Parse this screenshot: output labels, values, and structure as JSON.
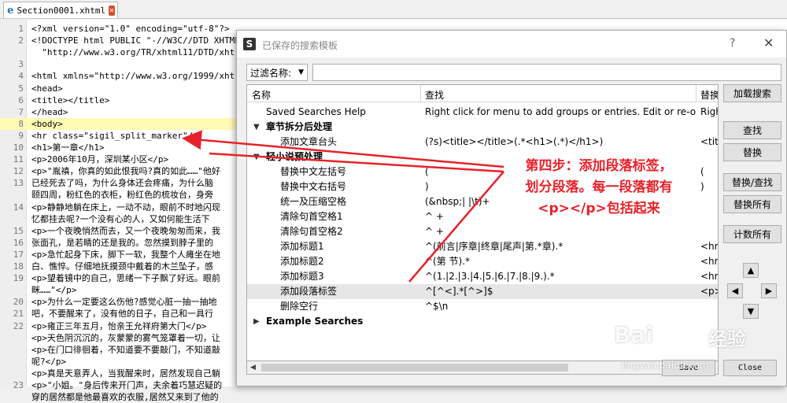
{
  "editor": {
    "tab_title": "Section0001.xhtml",
    "tab_icon": "e",
    "close_glyph": "✕",
    "lines": [
      {
        "no": "1",
        "text": "<?xml version=\"1.0\" encoding=\"utf-8\"?>"
      },
      {
        "no": "2",
        "text": "<!DOCTYPE html PUBLIC \"-//W3C//DTD XHTML"
      },
      {
        "no": "",
        "text": "  \"http://www.w3.org/TR/xhtml11/DTD/xht"
      },
      {
        "no": "3",
        "text": ""
      },
      {
        "no": "4",
        "text": "<html xmlns=\"http://www.w3.org/1999/xht"
      },
      {
        "no": "5",
        "text": "<head>"
      },
      {
        "no": "6",
        "text": "<title></title>"
      },
      {
        "no": "7",
        "text": "</head>"
      },
      {
        "no": "8",
        "text": "<body>"
      },
      {
        "no": "9",
        "text": "<hr class=\"sigil_split_marker\"/>"
      },
      {
        "no": "10",
        "text": "<h1>第一章</h1>"
      },
      {
        "no": "11",
        "text": "<p>2006年10月，深圳某小区</p>"
      },
      {
        "no": "12",
        "text": "<p>\"胤禛，你真的如此恨我吗?真的如此……\"他好"
      },
      {
        "no": "13",
        "text": "已经死去了吗，为什么身体还会疼痛，为什么脑"
      },
      {
        "no": "",
        "text": "颐四周，粉红色的衣柜，粉红色的梳妆台，身旁"
      },
      {
        "no": "14",
        "text": "<p>静静地躺在床上，一动不动，眼前不时地闪现"
      },
      {
        "no": "",
        "text": "忆都挂去呢?一个没有心的人，又如何能生活下"
      },
      {
        "no": "15",
        "text": "<p>一个夜晚悄然而去，又一个夜晚匆匆而来，我"
      },
      {
        "no": "16",
        "text": "张面孔，是若睛的还是我的。忽然摸到脖子里的"
      },
      {
        "no": "17",
        "text": "<p>急忙起身下床，脚下一软，我整个人瘫坐在地"
      },
      {
        "no": "18",
        "text": "白、憔悴。仔细地抚摸颈中戴着的木兰坠子，感"
      },
      {
        "no": "19",
        "text": "<p>望着镜中的自己，思绪一下子飘了好远。眼前"
      },
      {
        "no": "",
        "text": "眯……\"</p>"
      },
      {
        "no": "20",
        "text": "<p>为什么一定要这么伤他?感觉心脏一抽一抽地"
      },
      {
        "no": "21",
        "text": "吧，不要醒来了，没有他的日子，自己和一具行"
      },
      {
        "no": "22",
        "text": "<p>雍正三年五月，怡亲王允祥府第大门</p>"
      },
      {
        "no": "",
        "text": "<p>天色阴沉沉的，灰蒙蒙的雾气笼罩着一切，让"
      },
      {
        "no": "",
        "text": "<p>在门口徘徊着，不知道要不要敲门，不知道敲"
      },
      {
        "no": "",
        "text": "呢?</p>"
      },
      {
        "no": "",
        "text": "<p>真是天意弄人，当我醒来时，居然发现自己躺"
      },
      {
        "no": "23",
        "text": "<p>\"小姐。\"身后传来开门声，夫余着巧慧迟疑的"
      },
      {
        "no": "",
        "text": "穿的居然都是他最喜欢的衣服,居然又来到了他的"
      }
    ]
  },
  "dialog": {
    "title": "已保存的搜索模板",
    "app_icon": "S",
    "help_label": "?",
    "close_label": "✕",
    "filter_label": "过滤名称:",
    "filter_value": "",
    "columns": [
      "名称",
      "查找",
      "替换"
    ],
    "rows": [
      {
        "name": "Saved Searches Help",
        "find": "Right click for menu to add groups or entries.  Edit or re-o...",
        "repl": "Righ",
        "group": false,
        "arrow": ""
      },
      {
        "name": "章节拆分后处理",
        "find": "",
        "repl": "",
        "group": true,
        "arrow": "▼"
      },
      {
        "name": "添加文章台头",
        "find": "(?s)<title></title>(.*<h1>(.*)</h1>)",
        "repl": "<titl",
        "group": false,
        "arrow": ""
      },
      {
        "name": "轻小说预处理",
        "find": "",
        "repl": "",
        "group": true,
        "arrow": "▼"
      },
      {
        "name": "替换中文左括号",
        "find": "(",
        "repl": "(",
        "group": false,
        "arrow": ""
      },
      {
        "name": "替换中文右括号",
        "find": ")",
        "repl": ")",
        "group": false,
        "arrow": ""
      },
      {
        "name": "统一及压缩空格",
        "find": "(&nbsp;|  |\\t)+",
        "repl": "",
        "group": false,
        "arrow": ""
      },
      {
        "name": "清除句首空格1",
        "find": "^ +",
        "repl": "",
        "group": false,
        "arrow": ""
      },
      {
        "name": "清除句首空格2",
        "find": "^ +",
        "repl": "",
        "group": false,
        "arrow": ""
      },
      {
        "name": "添加标题1",
        "find": "^(前言|序章|终章|尾声|第.*章).*",
        "repl": "<hr",
        "group": false,
        "arrow": ""
      },
      {
        "name": "添加标题2",
        "find": "^(第 节).*",
        "repl": "<hr",
        "group": false,
        "arrow": ""
      },
      {
        "name": "添加标题3",
        "find": "^(1.|2.|3.|4.|5.|6.|7.|8.|9.).*",
        "repl": "<hr",
        "group": false,
        "arrow": ""
      },
      {
        "name": "添加段落标签",
        "find": "^[^<].*[^>]$",
        "repl": "<p>",
        "group": false,
        "arrow": "",
        "selected": true
      },
      {
        "name": "删除空行",
        "find": "^$\\n",
        "repl": "",
        "group": false,
        "arrow": ""
      },
      {
        "name": "Example Searches",
        "find": "",
        "repl": "",
        "group": true,
        "arrow": "▶"
      }
    ],
    "side_buttons": {
      "load": "加载搜索",
      "find": "查找",
      "replace": "替换",
      "replace_find": "替换/查找",
      "replace_all": "替换所有",
      "count_all": "计数所有"
    },
    "arrow_up": "▲",
    "arrow_left": "◀",
    "arrow_right": "▶",
    "arrow_down": "▼",
    "save_label": "Save",
    "close_button_label": "Close"
  },
  "annotation": {
    "line1": "第四步：添加段落标签，",
    "line2": "划分段落。每一段落都有",
    "line3": "<p></p>包括起来",
    "color": "#e8222a"
  },
  "watermark": {
    "logo": "Bai",
    "text": "经验",
    "url": "jingyan.baidu.com"
  }
}
